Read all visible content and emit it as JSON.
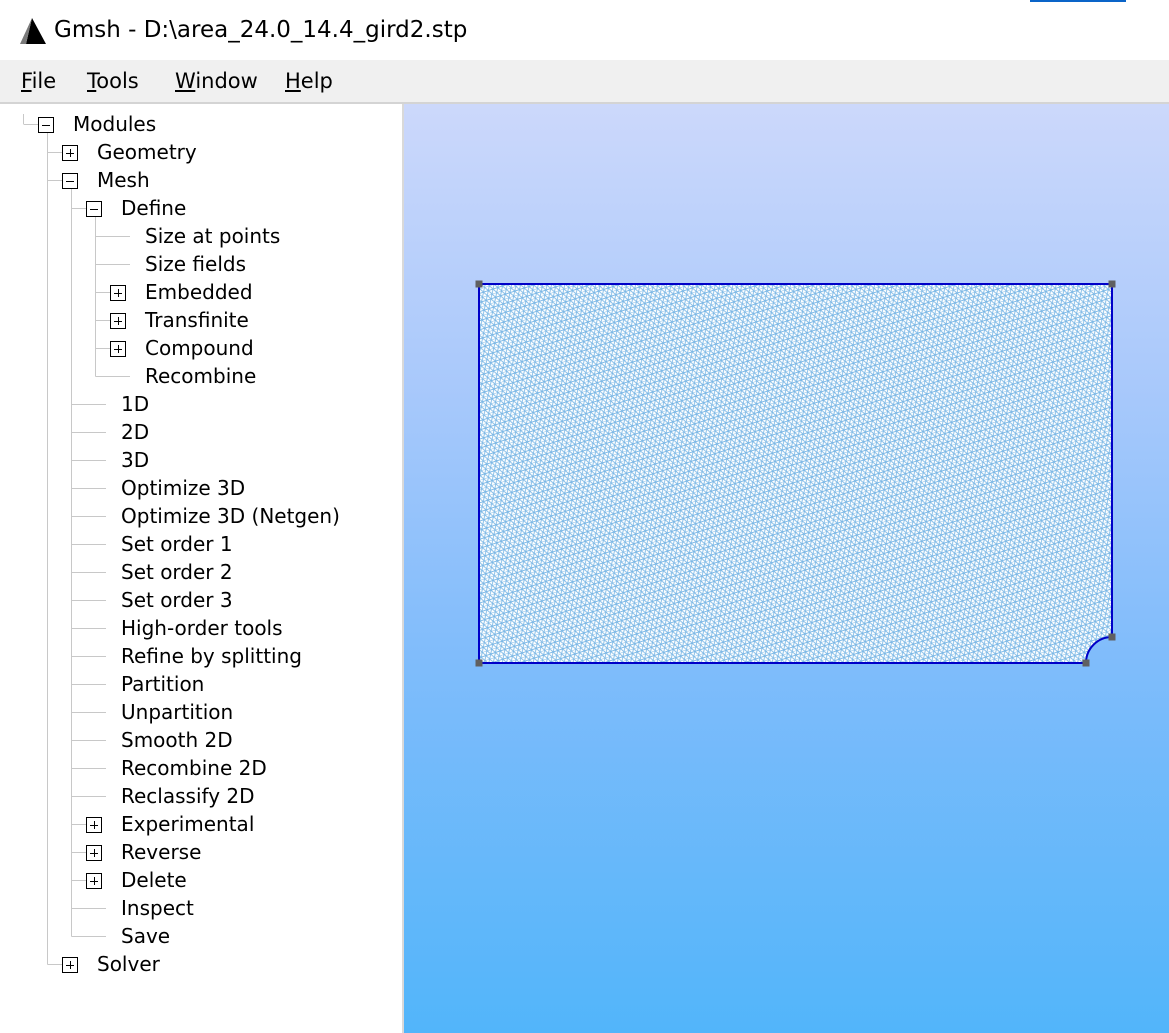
{
  "window": {
    "title": "Gmsh - D:\\area_24.0_14.4_gird2.stp",
    "icon": "gmsh-logo-icon"
  },
  "menubar": {
    "items": [
      {
        "mnemonic": "F",
        "rest": "ile"
      },
      {
        "mnemonic": "T",
        "rest": "ools"
      },
      {
        "mnemonic": "W",
        "rest": "indow"
      },
      {
        "mnemonic": "H",
        "rest": "elp"
      }
    ]
  },
  "tree": {
    "root": "Modules",
    "geometry": "Geometry",
    "mesh": "Mesh",
    "define": "Define",
    "define_children": [
      "Size at points",
      "Size fields",
      "Embedded",
      "Transfinite",
      "Compound",
      "Recombine"
    ],
    "mesh_children": [
      "1D",
      "2D",
      "3D",
      "Optimize 3D",
      "Optimize 3D (Netgen)",
      "Set order 1",
      "Set order 2",
      "Set order 3",
      "High-order tools",
      "Refine by splitting",
      "Partition",
      "Unpartition",
      "Smooth 2D",
      "Recombine 2D",
      "Reclassify 2D",
      "Experimental",
      "Reverse",
      "Delete",
      "Inspect",
      "Save"
    ],
    "solver": "Solver"
  },
  "viewport": {
    "background_top": "#ccd8fb",
    "background_bottom": "#52b5fa",
    "geometry_line_color": "#0000c8",
    "point_color": "#606060",
    "mesh_color": "#ffffff"
  }
}
